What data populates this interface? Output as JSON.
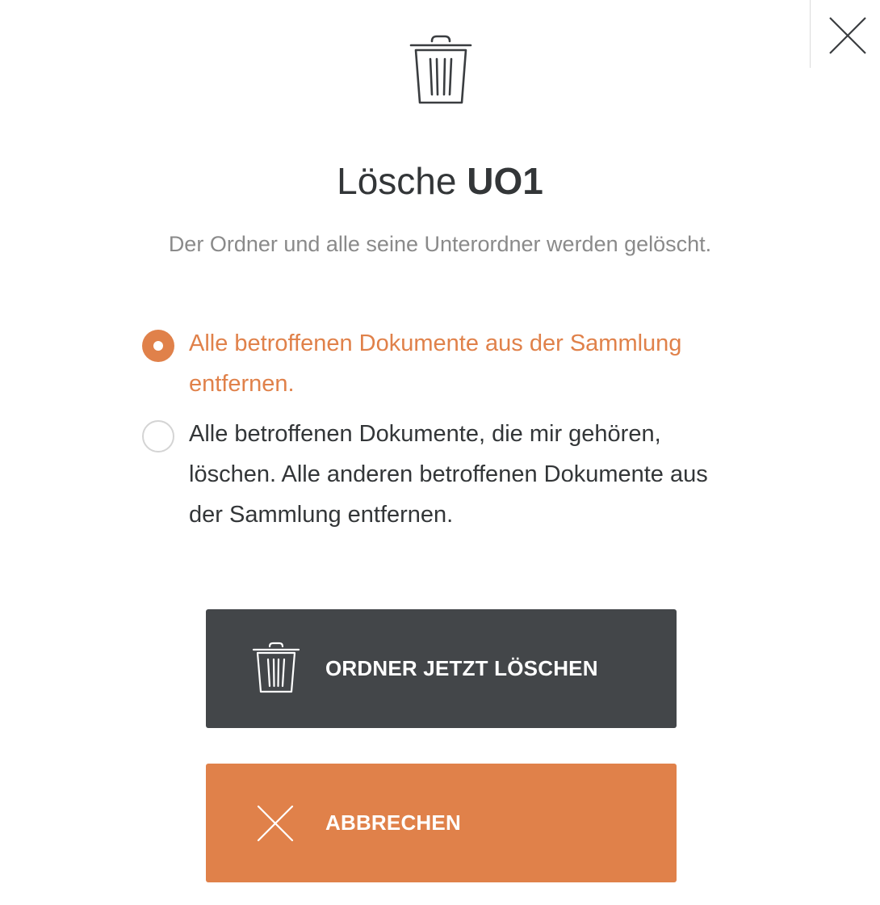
{
  "dialog": {
    "title_prefix": "Lösche ",
    "title_name": "UO1",
    "subtitle": "Der Ordner und alle seine Unterordner werden gelöscht.",
    "icons": {
      "hero": "trash-icon",
      "close": "close-icon"
    }
  },
  "options": [
    {
      "label": "Alle betroffenen Dokumente aus der Sammlung entfernen.",
      "selected": true
    },
    {
      "label": "Alle betroffenen Dokumente, die mir gehören, löschen. Alle anderen betroffenen Dokumente aus der Sammlung entfernen.",
      "selected": false
    }
  ],
  "buttons": {
    "delete_label": "ORDNER JETZT LÖSCHEN",
    "cancel_label": "ABBRECHEN"
  },
  "colors": {
    "accent": "#e0814a",
    "dark_button": "#434649",
    "text": "#333638",
    "muted": "#8a8a8a"
  }
}
